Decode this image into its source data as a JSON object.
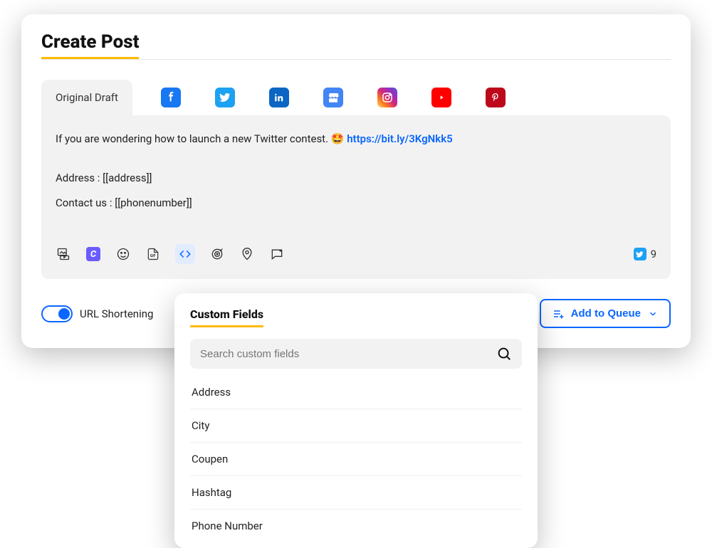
{
  "header": {
    "title": "Create Post"
  },
  "tabs": {
    "original": "Original Draft"
  },
  "social": {
    "facebook": "facebook-icon",
    "twitter": "twitter-icon",
    "linkedin": "linkedin-icon",
    "google": "google-business-icon",
    "instagram": "instagram-icon",
    "youtube": "youtube-icon",
    "pinterest": "pinterest-icon"
  },
  "editor": {
    "line1_prefix": "If you are wondering how to launch a new Twitter contest. ",
    "emoji": "🤩",
    "link": "https://bit.ly/3KgNkk5",
    "line2": "Address : [[address]]",
    "line3": "Contact us : [[phonenumber]]"
  },
  "toolbar_icons": {
    "media": "media-icon",
    "canva": "canva-icon",
    "emoji": "emoji-icon",
    "gif": "gif-icon",
    "code": "custom-fields-icon",
    "target": "target-icon",
    "location": "location-icon",
    "comment": "first-comment-icon"
  },
  "counter": {
    "value": "9"
  },
  "footer": {
    "url_shortening_label": "URL Shortening",
    "add_to_queue_label": "Add to Queue"
  },
  "popup": {
    "title": "Custom Fields",
    "search_placeholder": "Search custom fields",
    "items": [
      "Address",
      "City",
      "Coupen",
      "Hashtag",
      "Phone Number"
    ]
  }
}
